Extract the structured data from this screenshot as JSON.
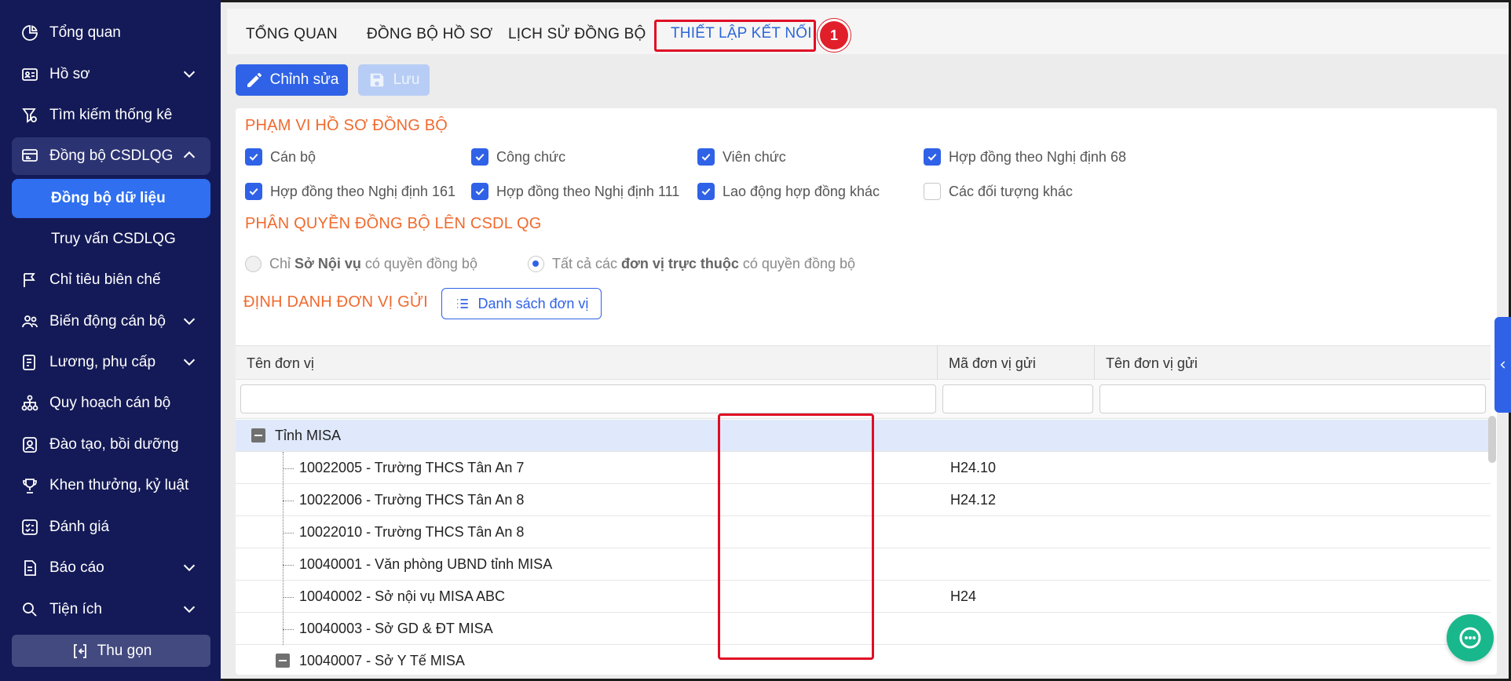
{
  "sidebar": {
    "items": [
      {
        "label": "Tổng quan",
        "icon": "pie-chart-icon"
      },
      {
        "label": "Hồ sơ",
        "icon": "id-card-icon"
      },
      {
        "label": "Tìm kiếm thống kê",
        "icon": "search-filter-icon"
      },
      {
        "label": "Đồng bộ CSDLQG",
        "icon": "database-sync-icon"
      },
      {
        "label": "Chỉ tiêu biên chế",
        "icon": "flag-icon"
      },
      {
        "label": "Biến động cán bộ",
        "icon": "people-icon"
      },
      {
        "label": "Lương, phụ cấp",
        "icon": "salary-icon"
      },
      {
        "label": "Quy hoạch cán bộ",
        "icon": "org-chart-icon"
      },
      {
        "label": "Đào tạo, bồi dưỡng",
        "icon": "training-icon"
      },
      {
        "label": "Khen thưởng, kỷ luật",
        "icon": "trophy-icon"
      },
      {
        "label": "Đánh giá",
        "icon": "checklist-icon"
      },
      {
        "label": "Báo cáo",
        "icon": "report-icon"
      },
      {
        "label": "Tiện ích",
        "icon": "search-icon"
      }
    ],
    "sub_items": [
      "Đồng bộ dữ liệu",
      "Truy vấn CSDLQG"
    ],
    "collapse_label": "Thu gọn"
  },
  "tabs": [
    "TỔNG QUAN",
    "ĐỒNG BỘ HỒ SƠ",
    "LỊCH SỬ ĐỒNG BỘ",
    "THIẾT LẬP KẾT NỐI"
  ],
  "step_badge": "1",
  "toolbar": {
    "edit_label": "Chỉnh sửa",
    "save_label": "Lưu"
  },
  "scope": {
    "title": "PHẠM VI HỒ SƠ ĐỒNG BỘ",
    "options": [
      {
        "label": "Cán bộ",
        "checked": true
      },
      {
        "label": "Công chức",
        "checked": true
      },
      {
        "label": "Viên chức",
        "checked": true
      },
      {
        "label": "Hợp đồng theo Nghị định 68",
        "checked": true
      },
      {
        "label": "Hợp đồng theo Nghị định 161",
        "checked": true
      },
      {
        "label": "Hợp đồng theo Nghị định 111",
        "checked": true
      },
      {
        "label": "Lao động hợp đồng khác",
        "checked": true
      },
      {
        "label": "Các đối tượng khác",
        "checked": false
      }
    ]
  },
  "permission": {
    "title": "PHÂN QUYỀN ĐỒNG BỘ LÊN CSDL QG",
    "opt1": {
      "pre": "Chỉ",
      "bold": "Sở Nội vụ",
      "post": "có quyền đồng bộ"
    },
    "opt2": {
      "pre": "Tất cả các",
      "bold": "đơn vị trực thuộc",
      "post": "có quyền đồng bộ"
    }
  },
  "sender": {
    "title": "ĐỊNH DANH ĐƠN VỊ GỬI",
    "list_button": "Danh sách đơn vị"
  },
  "table": {
    "columns": [
      "Tên đơn vị",
      "Mã đơn vị gửi",
      "Tên đơn vị gửi"
    ],
    "rows": [
      {
        "name": "Tỉnh MISA",
        "code": "",
        "sender_name": ""
      },
      {
        "name": "10022005 - Trường THCS Tân An 7",
        "code": "H24.10",
        "sender_name": ""
      },
      {
        "name": "10022006 - Trường THCS Tân An 8",
        "code": "H24.12",
        "sender_name": ""
      },
      {
        "name": "10022010 - Trường THCS Tân An 8",
        "code": "",
        "sender_name": ""
      },
      {
        "name": "10040001 - Văn phòng UBND tỉnh MISA",
        "code": "",
        "sender_name": ""
      },
      {
        "name": "10040002 - Sở nội vụ MISA ABC",
        "code": "H24",
        "sender_name": ""
      },
      {
        "name": "10040003 - Sở GD & ĐT MISA",
        "code": "",
        "sender_name": ""
      },
      {
        "name": "10040007 - Sở Y Tế MISA",
        "code": "",
        "sender_name": ""
      }
    ]
  },
  "colors": {
    "sidebar_bg": "#141a57",
    "accent": "#2f62e6",
    "section_title": "#f06a2e",
    "highlight": "#e00d25"
  }
}
